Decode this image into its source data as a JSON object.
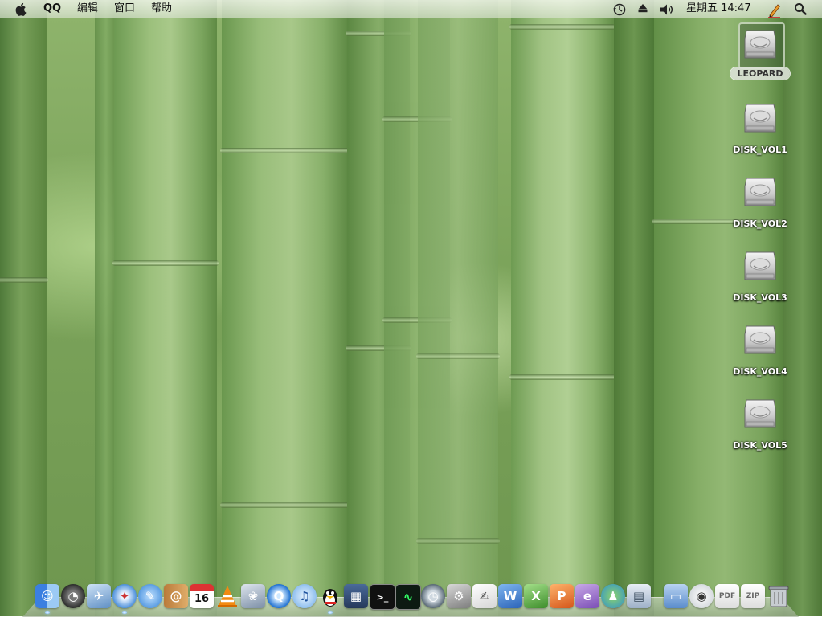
{
  "menubar": {
    "app_name": "QQ",
    "menus": [
      "编辑",
      "窗口",
      "帮助"
    ],
    "clock": "星期五 14:47",
    "status_icons": [
      "time-machine-icon",
      "eject-icon",
      "volume-icon",
      "input-method-pen-icon",
      "spotlight-icon"
    ]
  },
  "desktop": {
    "disks": [
      {
        "label": "LEOPARD",
        "selected": true
      },
      {
        "label": "DISK_VOL1",
        "selected": false
      },
      {
        "label": "DISK_VOL2",
        "selected": false
      },
      {
        "label": "DISK_VOL3",
        "selected": false
      },
      {
        "label": "DISK_VOL4",
        "selected": false
      },
      {
        "label": "DISK_VOL5",
        "selected": false
      }
    ]
  },
  "dock": {
    "calendar_day": "16",
    "items": [
      "finder-icon",
      "dashboard-icon",
      "mail-icon",
      "safari-icon",
      "ichat-icon",
      "address-book-icon",
      "ical-icon",
      "vlc-icon",
      "iphoto-icon",
      "quicktime-icon",
      "itunes-icon",
      "qq-icon",
      "spaces-icon",
      "terminal-icon",
      "activity-monitor-icon",
      "time-machine-icon",
      "system-preferences-icon",
      "textedit-icon",
      "word-icon",
      "excel-icon",
      "powerpoint-icon",
      "entourage-icon",
      "messenger-icon",
      "applications-stack-icon",
      "documents-stack-icon",
      "airport-icon",
      "pdf-document-icon",
      "zip-document-icon",
      "trash-icon"
    ]
  },
  "colors": {
    "wallpaper_green": "#7ba35a",
    "menubar": "#eef2ea",
    "label_text": "#ffffff"
  }
}
